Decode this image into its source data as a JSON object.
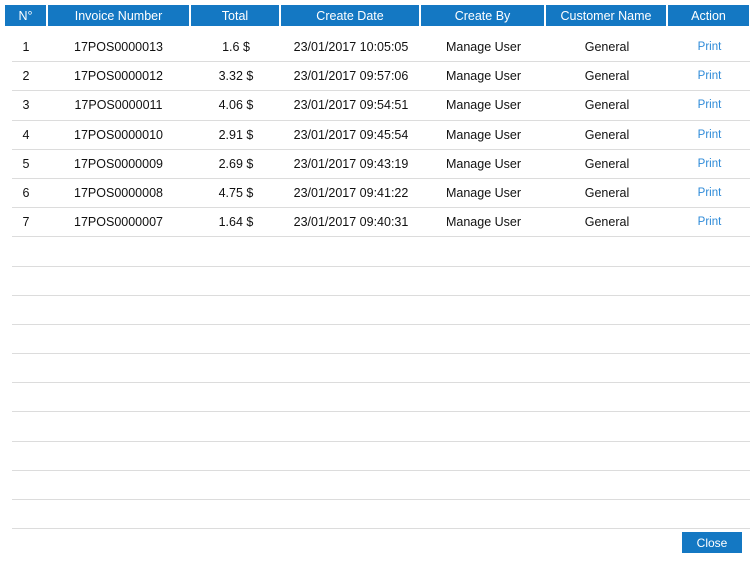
{
  "table": {
    "columns": [
      "N°",
      "Invoice Number",
      "Total",
      "Create Date",
      "Create By",
      "Customer Name",
      "Action"
    ],
    "rows": [
      {
        "n": "1",
        "invoice": "17POS0000013",
        "total": "1.6 $",
        "date": "23/01/2017 10:05:05",
        "by": "Manage User",
        "customer": "General",
        "action": "Print"
      },
      {
        "n": "2",
        "invoice": "17POS0000012",
        "total": "3.32 $",
        "date": "23/01/2017 09:57:06",
        "by": "Manage User",
        "customer": "General",
        "action": "Print"
      },
      {
        "n": "3",
        "invoice": "17POS0000011",
        "total": "4.06 $",
        "date": "23/01/2017 09:54:51",
        "by": "Manage User",
        "customer": "General",
        "action": "Print"
      },
      {
        "n": "4",
        "invoice": "17POS0000010",
        "total": "2.91 $",
        "date": "23/01/2017 09:45:54",
        "by": "Manage User",
        "customer": "General",
        "action": "Print"
      },
      {
        "n": "5",
        "invoice": "17POS0000009",
        "total": "2.69 $",
        "date": "23/01/2017 09:43:19",
        "by": "Manage User",
        "customer": "General",
        "action": "Print"
      },
      {
        "n": "6",
        "invoice": "17POS0000008",
        "total": "4.75 $",
        "date": "23/01/2017 09:41:22",
        "by": "Manage User",
        "customer": "General",
        "action": "Print"
      },
      {
        "n": "7",
        "invoice": "17POS0000007",
        "total": "1.64 $",
        "date": "23/01/2017 09:40:31",
        "by": "Manage User",
        "customer": "General",
        "action": "Print"
      }
    ],
    "empty_row_count": 10
  },
  "footer": {
    "close_label": "Close"
  },
  "colors": {
    "header_bg": "#1478c3",
    "link": "#2d8ad8",
    "divider": "#dcdcdc"
  }
}
